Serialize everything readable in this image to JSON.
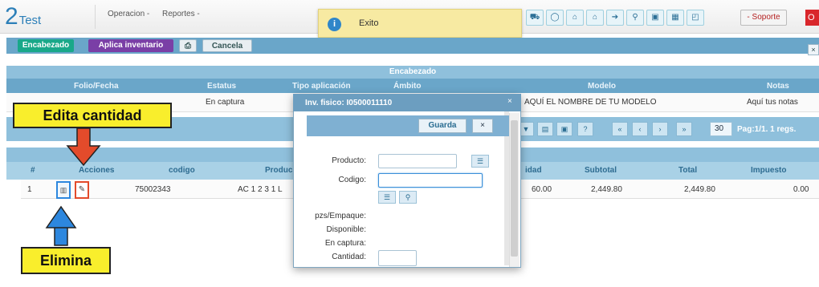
{
  "app": {
    "logo_num": "2",
    "logo_text": "Test"
  },
  "menu": {
    "operacion": "Operacion -",
    "reportes": "Reportes -"
  },
  "toolbar": {
    "icons": [
      "cart-icon",
      "circle-icon",
      "lock-icon",
      "lock-icon",
      "arrow-icon",
      "pin-icon",
      "save-icon",
      "grid-icon",
      "image-icon"
    ],
    "soporte": "- Soporte",
    "power": "O"
  },
  "toast": {
    "text": "Exito"
  },
  "actions": {
    "encabezado": "Encabezado",
    "aplica": "Aplica inventario",
    "cancela": "Cancela"
  },
  "encabezado": {
    "title": "Encabezado",
    "columns": [
      "Folio/Fecha",
      "Estatus",
      "Tipo aplicación",
      "Ámbito",
      "Modelo",
      "Notas"
    ],
    "values": {
      "estatus": "En captura",
      "modelo": "AQUÍ EL NOMBRE DE TU MODELO",
      "notas": "Aquí tus notas"
    }
  },
  "pager": {
    "page_size": "30",
    "info": "Pag:1/1. 1 regs."
  },
  "grid": {
    "columns": [
      "#",
      "Acciones",
      "codigo",
      "Produc",
      "idad",
      "Subtotal",
      "Total",
      "Impuesto"
    ],
    "row": {
      "num": "1",
      "codigo": "75002343",
      "producto": "AC 1 2 3 1 L",
      "cantidad": "60.00",
      "subtotal": "2,449.80",
      "total": "2,449.80",
      "impuesto": "0.00"
    }
  },
  "callouts": {
    "edita": "Edita cantidad",
    "elimina": "Elimina"
  },
  "modal": {
    "title": "Inv. fisico: I0500011110",
    "guarda": "Guarda",
    "close": "×",
    "labels": {
      "producto": "Producto:",
      "codigo": "Codigo:",
      "pzs": "pzs/Empaque:",
      "disponible": "Disponible:",
      "en_captura": "En captura:",
      "cantidad": "Cantidad:"
    }
  },
  "colors": {
    "header_blue": "#6aa6c9",
    "light_blue": "#8fc0dc",
    "teal": "#19a889",
    "purple": "#7a3fa6",
    "callout_yellow": "#f9ee2c",
    "arrow_red": "#e34b2b",
    "arrow_blue": "#2d87de"
  }
}
